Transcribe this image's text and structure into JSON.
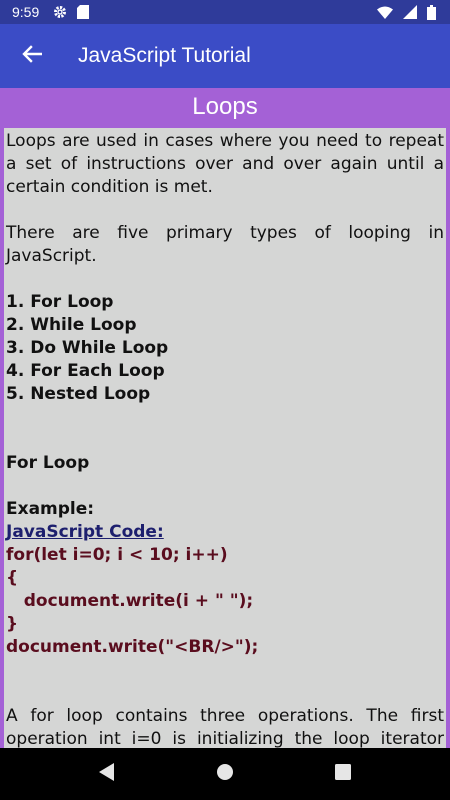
{
  "status_bar": {
    "time": "9:59",
    "icons": [
      "gear-icon",
      "sd-card-icon",
      "wifi-icon",
      "signal-icon",
      "battery-icon"
    ]
  },
  "app_bar": {
    "title": "JavaScript Tutorial",
    "back_icon": "arrow-left-icon"
  },
  "section": {
    "title": "Loops"
  },
  "content": {
    "intro": "Loops are used in cases where you need to repeat a set of instructions over and over again until a certain condition is met.",
    "types_intro": "There are five primary types of looping in JavaScript.",
    "types": [
      "1. For Loop",
      "2. While Loop",
      "3. Do While Loop",
      "4. For Each Loop",
      "5. Nested Loop"
    ],
    "for_heading": "For Loop",
    "example_label": "Example:",
    "code_label": "JavaScript Code:",
    "code_lines": [
      "for(let i=0; i < 10; i++)",
      "{",
      "   document.write(i + \" \");",
      "}",
      "document.write(\"<BR/>\");"
    ],
    "explanation": "A for loop contains three operations. The first operation int i=0 is initializing the loop iterator with"
  },
  "colors": {
    "status_bar": "#2f3b9a",
    "app_bar": "#3b4cc6",
    "section_bg": "#a461d6",
    "content_bg": "#d5d6d5",
    "code_text": "#5a0d1e",
    "code_link": "#1d1f6e"
  },
  "nav_bar": {
    "buttons": [
      "back-triangle-icon",
      "home-circle-icon",
      "recents-square-icon"
    ]
  }
}
